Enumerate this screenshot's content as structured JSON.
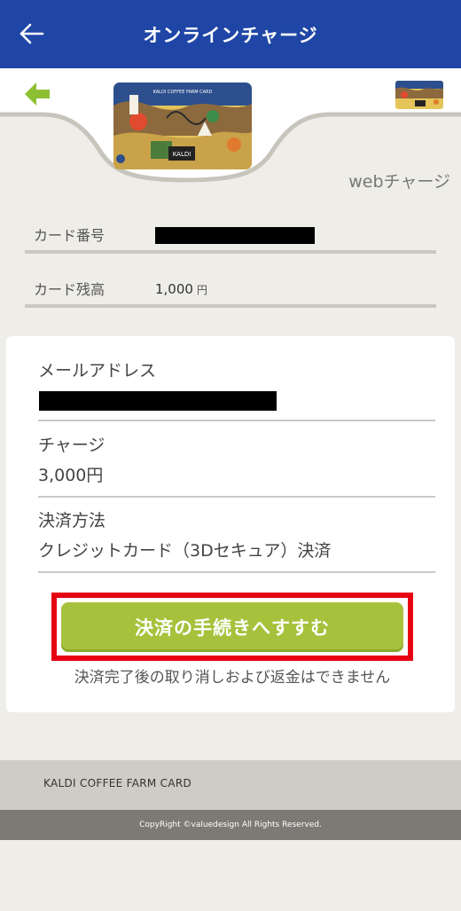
{
  "nav": {
    "title": "オンラインチャージ",
    "back_icon": "arrow-left-icon"
  },
  "header": {
    "back_icon": "green-arrow-left-icon",
    "card_image_text": "KALDI COFFEE FARM CARD",
    "card_logo_text": "KALDI",
    "accent_color": "#8dbf33"
  },
  "section_label": "webチャージ",
  "card_info": {
    "number_label": "カード番号",
    "balance_label": "カード残高",
    "balance_value": "1,000",
    "balance_unit": "円"
  },
  "form": {
    "email_label": "メールアドレス",
    "charge_label": "チャージ",
    "charge_value": "3,000円",
    "payment_label": "決済方法",
    "payment_value": "クレジットカード（3Dセキュア）決済",
    "submit_label": "決済の手続きへすすむ",
    "notice": "決済完了後の取り消しおよび返金はできません"
  },
  "footer": {
    "brand": "KALDI COFFEE FARM CARD",
    "copyright": "CopyRight ©valuedesign All Rights Reserved."
  },
  "colors": {
    "nav_bg": "#1f46a6",
    "button_bg": "#a6c23c",
    "highlight_border": "#e60012"
  }
}
